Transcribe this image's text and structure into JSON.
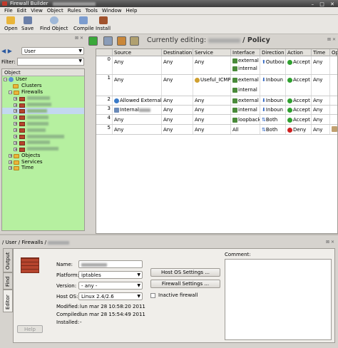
{
  "window": {
    "title": "Firewall Builder",
    "title_controls": "– □ ✕"
  },
  "menu": [
    "File",
    "Edit",
    "View",
    "Object",
    "Rules",
    "Tools",
    "Window",
    "Help"
  ],
  "toolbar": {
    "open": "Open",
    "save": "Save",
    "find": "Find Object",
    "compile": "Compile",
    "install": "Install"
  },
  "left": {
    "library": "User",
    "filter_label": "Filter:",
    "tree_header": "Object",
    "tree": {
      "user": "User",
      "clusters": "Clusters",
      "firewalls": "Firewalls",
      "objects": "Objects",
      "services": "Services",
      "time": "Time"
    }
  },
  "policy": {
    "editing_prefix": "Currently editing:",
    "editing_suffix": "/ Policy",
    "columns": [
      "Source",
      "Destination",
      "Service",
      "Interface",
      "Direction",
      "Action",
      "Time",
      "Op"
    ],
    "rows": [
      {
        "num": "0",
        "source": "Any",
        "dest": "Any",
        "service": "Any",
        "iface": [
          "external",
          "internal"
        ],
        "dir": "Outbou",
        "action": "Accept",
        "time": "Any"
      },
      {
        "num": "1",
        "source": "Any",
        "dest": "Any",
        "service": "Useful_ICMP",
        "iface": [
          "external",
          "internal"
        ],
        "dir": "Inboun",
        "action": "Accept",
        "time": "Any"
      },
      {
        "num": "2",
        "source": "Allowed Externals",
        "dest": "Any",
        "service": "Any",
        "iface": [
          "external"
        ],
        "dir": "Inboun",
        "action": "Accept",
        "time": "Any"
      },
      {
        "num": "3",
        "source": "Internal",
        "dest": "Any",
        "service": "Any",
        "iface": [
          "internal"
        ],
        "dir": "Inboun",
        "action": "Accept",
        "time": "Any"
      },
      {
        "num": "4",
        "source": "Any",
        "dest": "Any",
        "service": "Any",
        "iface": [
          "loopback"
        ],
        "dir": "Both",
        "action": "Accept",
        "time": "Any"
      },
      {
        "num": "5",
        "source": "Any",
        "dest": "Any",
        "service": "Any",
        "iface": [
          "All"
        ],
        "dir": "Both",
        "action": "Deny",
        "time": "Any"
      }
    ]
  },
  "editor": {
    "breadcrumb": "/ User / Firewalls /",
    "tabs": [
      "Output",
      "Find",
      "Editor"
    ],
    "name_label": "Name:",
    "platform_label": "Platform:",
    "platform": "iptables",
    "version_label": "Version:",
    "version": "- any -",
    "hostos_label": "Host OS:",
    "hostos": "Linux 2.4/2.6",
    "modified_label": "Modified:",
    "modified": "lun mar 28 10:58:20 2011",
    "compiled_label": "Compiled:",
    "compiled": "lun mar 28 15:54:49 2011",
    "installed_label": "Installed:",
    "installed": "-",
    "hostos_settings": "Host OS Settings ...",
    "fw_settings": "Firewall Settings ...",
    "inactive": "Inactive firewall",
    "comment_label": "Comment:",
    "help": "Help"
  }
}
